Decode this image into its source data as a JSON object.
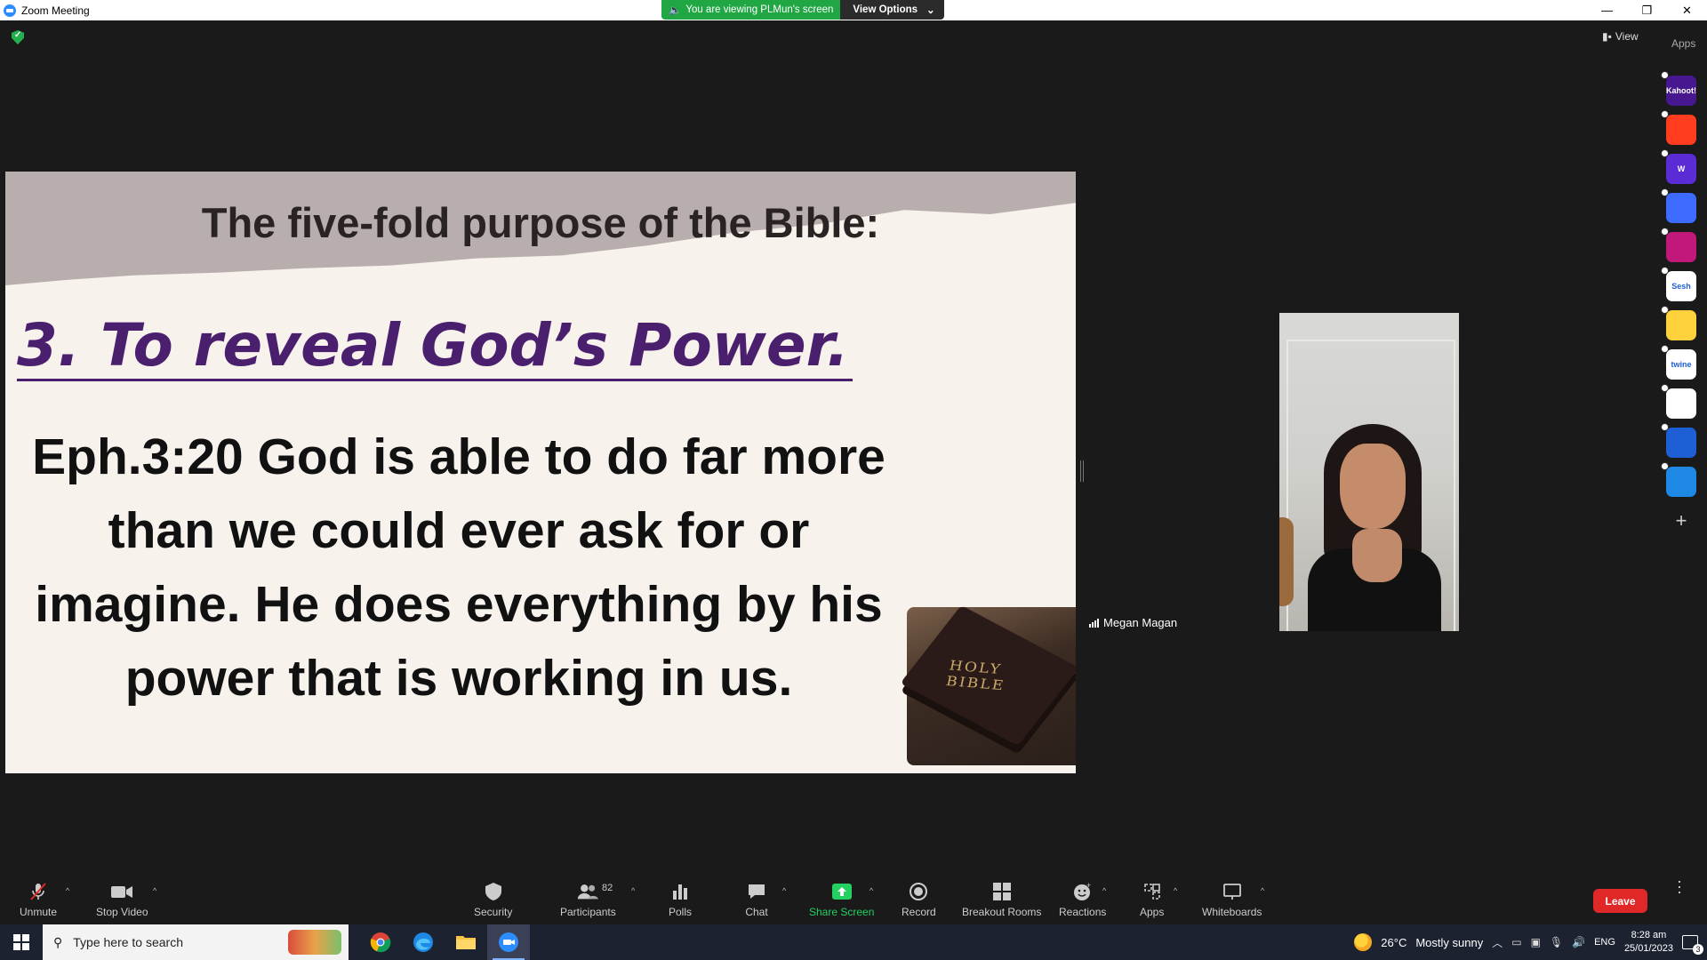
{
  "window": {
    "title": "Zoom Meeting"
  },
  "share_banner": {
    "viewing_text": "You are viewing PLMun's screen",
    "view_options_label": "View Options"
  },
  "top_right": {
    "view_label": "View",
    "apps_label": "Apps"
  },
  "apps_rail": [
    {
      "name": "kahoot",
      "label": "Kahoot!",
      "color": "#46178f"
    },
    {
      "name": "app-red",
      "label": "",
      "color": "#ff3c1e"
    },
    {
      "name": "wooclap",
      "label": "W",
      "color": "#5b2bd6"
    },
    {
      "name": "app-blue-ring",
      "label": "",
      "color": "#3d6bff"
    },
    {
      "name": "app-magenta",
      "label": "",
      "color": "#c2187a"
    },
    {
      "name": "sesh",
      "label": "Sesh",
      "color": "#ffffff"
    },
    {
      "name": "app-emoji",
      "label": "",
      "color": "#ffd23c"
    },
    {
      "name": "twine",
      "label": "twine",
      "color": "#ffffff"
    },
    {
      "name": "app-grid",
      "label": "",
      "color": "#ffffff"
    },
    {
      "name": "app-sync",
      "label": "",
      "color": "#1e5fd6"
    },
    {
      "name": "app-stack",
      "label": "",
      "color": "#1e88e5"
    }
  ],
  "slide": {
    "title": "The five-fold purpose of the Bible:",
    "heading": "3. To reveal God’s Power.",
    "body": "Eph.3:20 God is able to do far more than we could ever ask for or imagine. He does everything by his power that is working in us.",
    "book_label": "HOLY BIBLE"
  },
  "participant_video": {
    "name": "Megan Magan"
  },
  "toolbar": {
    "unmute": "Unmute",
    "stop_video": "Stop Video",
    "security": "Security",
    "participants": "Participants",
    "participants_count": "82",
    "polls": "Polls",
    "chat": "Chat",
    "share_screen": "Share Screen",
    "record": "Record",
    "breakout_rooms": "Breakout Rooms",
    "reactions": "Reactions",
    "apps": "Apps",
    "whiteboards": "Whiteboards",
    "leave": "Leave"
  },
  "taskbar": {
    "search_placeholder": "Type here to search",
    "weather_temp": "26°C",
    "weather_desc": "Mostly sunny",
    "lang": "ENG",
    "time": "8:28 am",
    "date": "25/01/2023",
    "notification_count": "3"
  }
}
